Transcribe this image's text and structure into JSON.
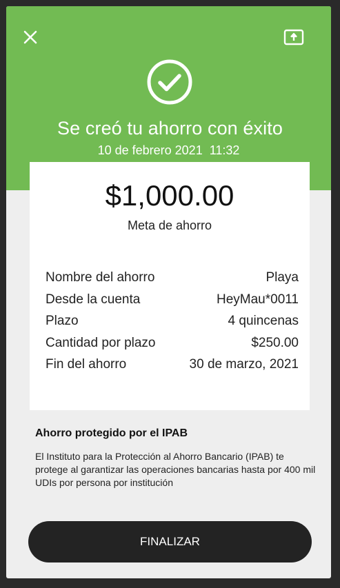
{
  "header": {
    "title": "Se creó tu ahorro con éxito",
    "datetime": "10 de febrero 2021  11:32"
  },
  "icons": {
    "close": "close-icon",
    "share": "share-icon",
    "success": "check-circle-icon"
  },
  "colors": {
    "accent": "#72bb53",
    "button": "#232323",
    "background": "#eeeeee"
  },
  "summary": {
    "amount": "$1,000.00",
    "amount_label": "Meta de ahorro",
    "rows": [
      {
        "label": "Nombre del ahorro",
        "value": "Playa"
      },
      {
        "label": "Desde la cuenta",
        "value": "HeyMau*0011"
      },
      {
        "label": "Plazo",
        "value": "4 quincenas"
      },
      {
        "label": "Cantidad por plazo",
        "value": "$250.00"
      },
      {
        "label": "Fin del ahorro",
        "value": "30 de marzo, 2021"
      }
    ]
  },
  "info": {
    "title": "Ahorro protegido por el IPAB",
    "text": "El Instituto para la Protección al Ahorro Bancario (IPAB) te protege al garantizar las operaciones bancarias hasta por 400 mil UDIs por persona por institución"
  },
  "actions": {
    "finish_label": "FINALIZAR"
  }
}
